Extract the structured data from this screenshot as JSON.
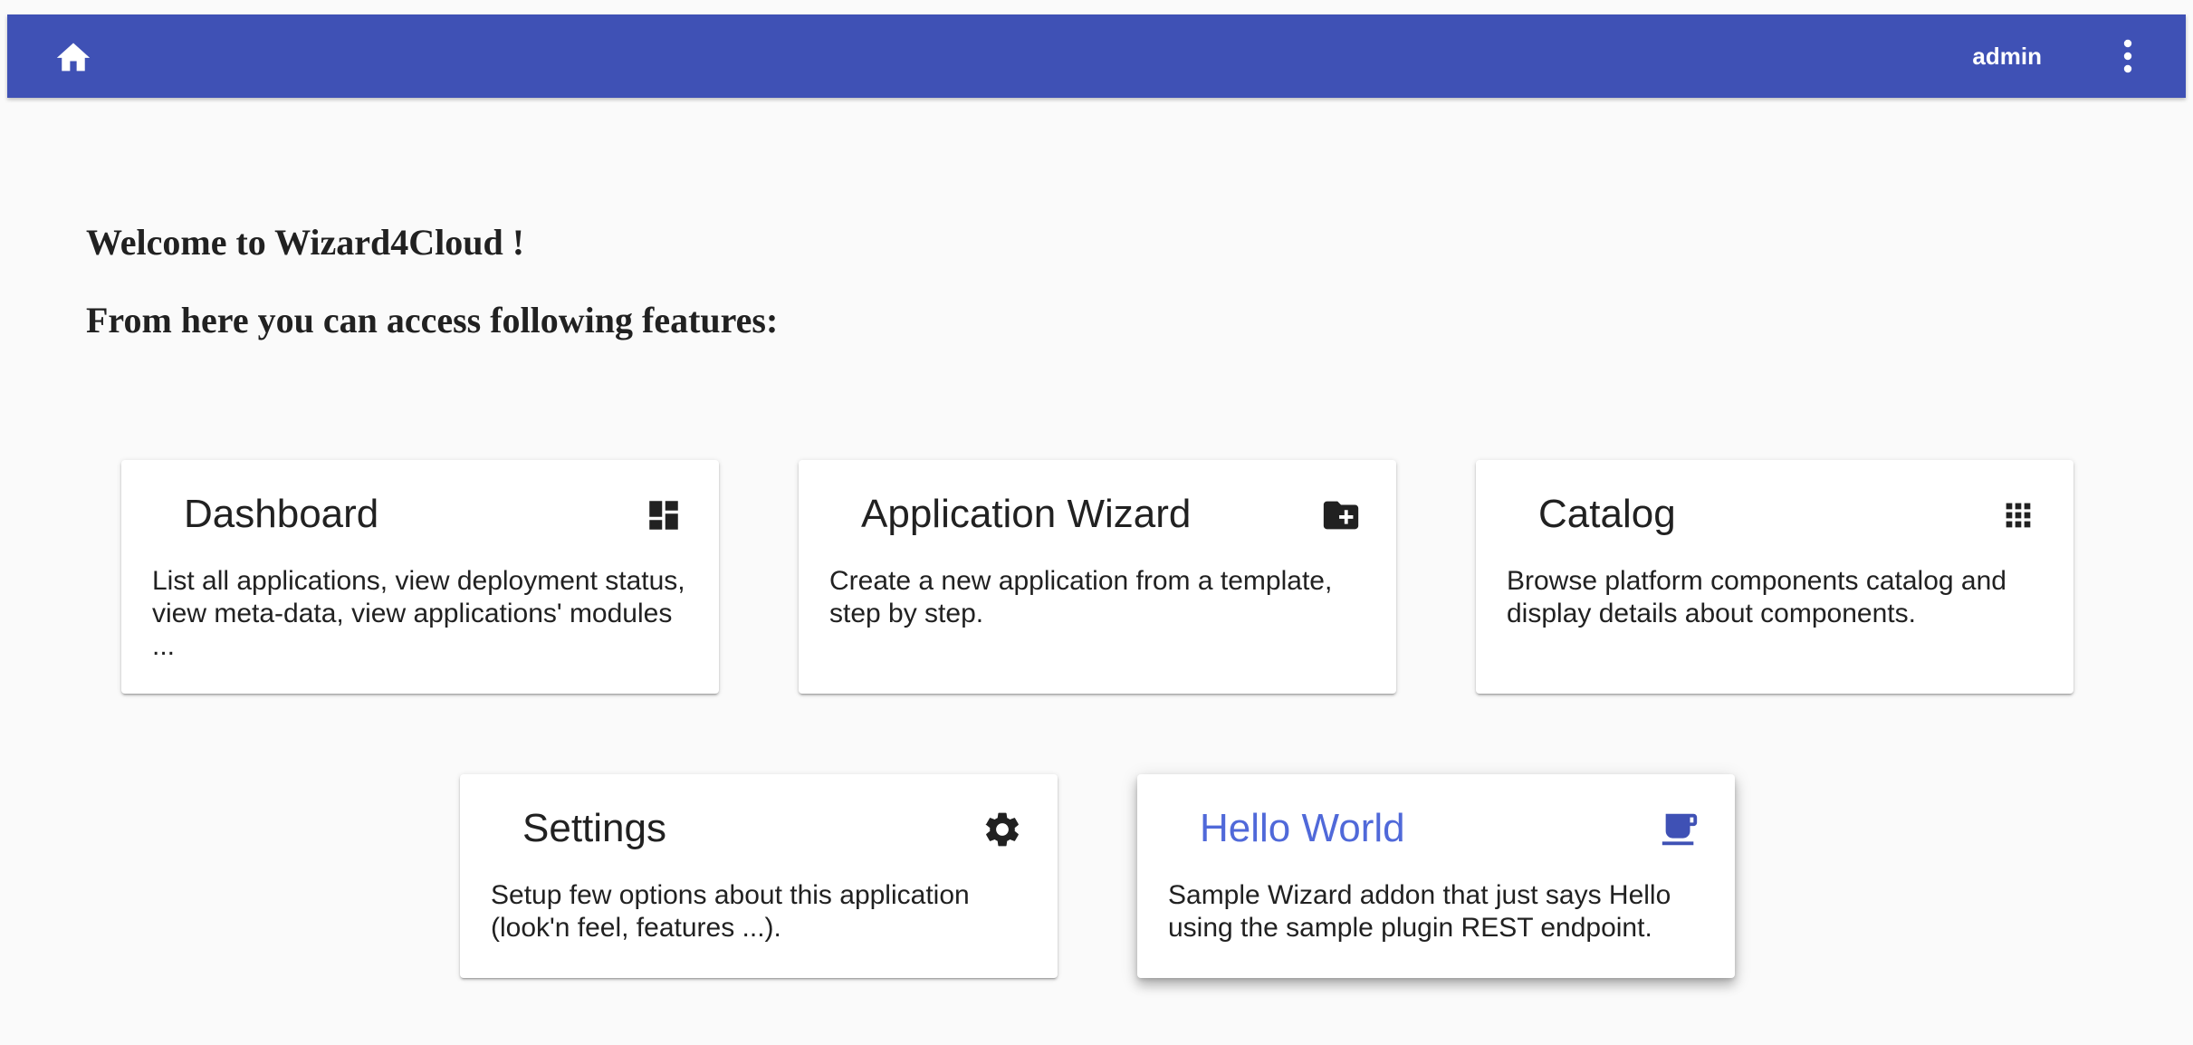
{
  "header": {
    "home_icon": "home-icon",
    "user": "admin",
    "menu_icon": "more-vert-icon",
    "bar_color": "#3f51b5"
  },
  "main": {
    "welcome": "Welcome to Wizard4Cloud !",
    "subtitle": "From here you can access following features:"
  },
  "cards": [
    {
      "title": "Dashboard",
      "icon": "dashboard-icon",
      "description": "List all applications, view deployment status, view meta-data, view applications' modules ..."
    },
    {
      "title": "Application Wizard",
      "icon": "create-new-folder-icon",
      "description": "Create a new application from a template, step by step."
    },
    {
      "title": "Catalog",
      "icon": "apps-grid-icon",
      "description": "Browse platform components catalog and display details about components."
    },
    {
      "title": "Settings",
      "icon": "settings-gear-icon",
      "description": "Setup few options about this application (look'n feel, features ...)."
    },
    {
      "title": "Hello World",
      "icon": "coffee-cup-icon",
      "description": "Sample Wizard addon that just says Hello using the sample plugin REST endpoint.",
      "accent": "#5069d9"
    }
  ]
}
